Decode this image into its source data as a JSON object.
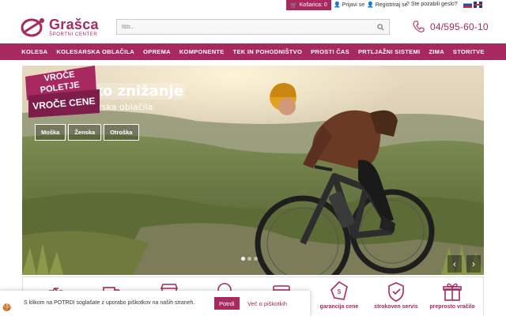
{
  "topbar": {
    "cart": "Košarica: 0",
    "login": "Prijavi se",
    "register": "Registriraj se",
    "forgot": "Ste pozabili geslo?",
    "languages": [
      "SI",
      "EN"
    ]
  },
  "brand": {
    "name": "Grašca",
    "tagline": "ŠPORTNI CENTER",
    "color": "#a8295f"
  },
  "search": {
    "placeholder": "Išči..."
  },
  "contact": {
    "phone": "04/595-60-10"
  },
  "nav": {
    "items": [
      "KOLESA",
      "KOLESARSKA OBLAČILA",
      "OPREMA",
      "KOMPONENTE",
      "TEK IN POHODNIŠTVO",
      "PROSTI ČAS",
      "PRTLJAŽNI SISTEMI",
      "ZIMA",
      "STORITVE"
    ]
  },
  "hero": {
    "title": "Sezonsko znižanje",
    "subtitle": "Poletna kolesarska oblačila",
    "buttons": [
      "Moška",
      "Ženska",
      "Otroška"
    ],
    "promo_line1": "VROČE",
    "promo_line2": "POLETJE",
    "promo_line3": "VROČE CENE",
    "slide_count": 3,
    "active_slide": 0
  },
  "features": {
    "items": [
      {
        "label": "",
        "icon": "bike-icon"
      },
      {
        "label": "",
        "icon": "truck-icon"
      },
      {
        "label": "",
        "icon": "store-icon"
      },
      {
        "label": "",
        "icon": "badge-icon"
      },
      {
        "label": "",
        "icon": "card-icon"
      },
      {
        "label": "garancija cene",
        "icon": "price-tag-icon"
      },
      {
        "label": "strokoven servis",
        "icon": "shield-check-icon"
      },
      {
        "label": "preprosto vračilo",
        "icon": "gift-box-icon"
      }
    ]
  },
  "cookie": {
    "text": "S klikom na POTRDI soglašate z uporabo piškotkov na naših straneh.",
    "accept": "Potrdi",
    "more": "Več o piškotkih"
  }
}
